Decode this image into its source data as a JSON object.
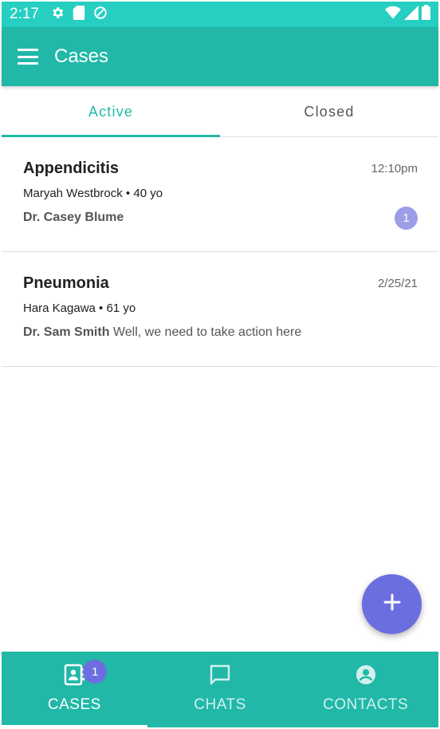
{
  "status_bar": {
    "time": "2:17",
    "icons_left": [
      "gear-icon",
      "sd-card-icon",
      "sync-icon"
    ],
    "icons_right": [
      "wifi-icon",
      "signal-icon",
      "battery-icon"
    ]
  },
  "app_bar": {
    "title": "Cases",
    "menu_icon": "hamburger-menu-icon"
  },
  "tabs": [
    {
      "label": "Active",
      "selected": true
    },
    {
      "label": "Closed",
      "selected": false
    }
  ],
  "cases": [
    {
      "title": "Appendicitis",
      "time": "12:10pm",
      "patient": "Maryah Westbrock • 40 yo",
      "doctor": "Dr. Casey Blume",
      "message": "",
      "badge": "1"
    },
    {
      "title": "Pneumonia",
      "time": "2/25/21",
      "patient": "Hara Kagawa • 61 yo",
      "doctor": "Dr. Sam Smith",
      "message": " Well, we need to take action here",
      "badge": ""
    }
  ],
  "fab": {
    "icon": "plus-icon"
  },
  "bottom_nav": [
    {
      "label": "CASES",
      "icon": "contacts-book-icon",
      "badge": "1",
      "selected": true
    },
    {
      "label": "CHATS",
      "icon": "chat-bubble-icon",
      "badge": "",
      "selected": false
    },
    {
      "label": "CONTACTS",
      "icon": "account-circle-icon",
      "badge": "",
      "selected": false
    }
  ],
  "colors": {
    "status_bar": "#26cfc1",
    "primary": "#21b8a8",
    "accent": "#6c6ee0",
    "badge_light": "#9b9de6"
  }
}
